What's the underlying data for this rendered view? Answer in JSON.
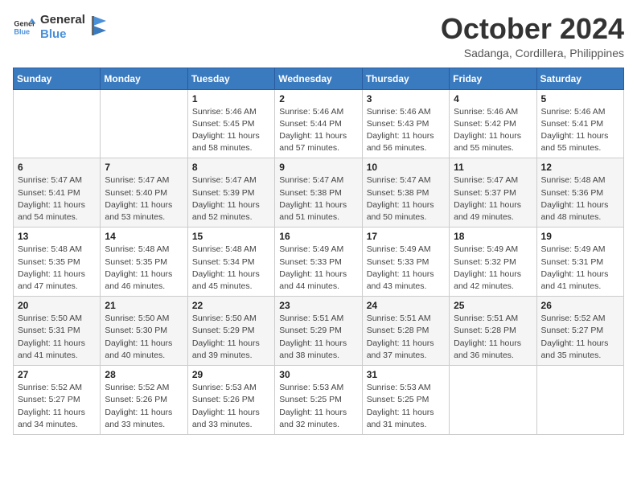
{
  "logo": {
    "text_general": "General",
    "text_blue": "Blue"
  },
  "header": {
    "title": "October 2024",
    "subtitle": "Sadanga, Cordillera, Philippines"
  },
  "days_of_week": [
    "Sunday",
    "Monday",
    "Tuesday",
    "Wednesday",
    "Thursday",
    "Friday",
    "Saturday"
  ],
  "weeks": [
    [
      {
        "day": "",
        "sunrise": "",
        "sunset": "",
        "daylight": ""
      },
      {
        "day": "",
        "sunrise": "",
        "sunset": "",
        "daylight": ""
      },
      {
        "day": "1",
        "sunrise": "Sunrise: 5:46 AM",
        "sunset": "Sunset: 5:45 PM",
        "daylight": "Daylight: 11 hours and 58 minutes."
      },
      {
        "day": "2",
        "sunrise": "Sunrise: 5:46 AM",
        "sunset": "Sunset: 5:44 PM",
        "daylight": "Daylight: 11 hours and 57 minutes."
      },
      {
        "day": "3",
        "sunrise": "Sunrise: 5:46 AM",
        "sunset": "Sunset: 5:43 PM",
        "daylight": "Daylight: 11 hours and 56 minutes."
      },
      {
        "day": "4",
        "sunrise": "Sunrise: 5:46 AM",
        "sunset": "Sunset: 5:42 PM",
        "daylight": "Daylight: 11 hours and 55 minutes."
      },
      {
        "day": "5",
        "sunrise": "Sunrise: 5:46 AM",
        "sunset": "Sunset: 5:41 PM",
        "daylight": "Daylight: 11 hours and 55 minutes."
      }
    ],
    [
      {
        "day": "6",
        "sunrise": "Sunrise: 5:47 AM",
        "sunset": "Sunset: 5:41 PM",
        "daylight": "Daylight: 11 hours and 54 minutes."
      },
      {
        "day": "7",
        "sunrise": "Sunrise: 5:47 AM",
        "sunset": "Sunset: 5:40 PM",
        "daylight": "Daylight: 11 hours and 53 minutes."
      },
      {
        "day": "8",
        "sunrise": "Sunrise: 5:47 AM",
        "sunset": "Sunset: 5:39 PM",
        "daylight": "Daylight: 11 hours and 52 minutes."
      },
      {
        "day": "9",
        "sunrise": "Sunrise: 5:47 AM",
        "sunset": "Sunset: 5:38 PM",
        "daylight": "Daylight: 11 hours and 51 minutes."
      },
      {
        "day": "10",
        "sunrise": "Sunrise: 5:47 AM",
        "sunset": "Sunset: 5:38 PM",
        "daylight": "Daylight: 11 hours and 50 minutes."
      },
      {
        "day": "11",
        "sunrise": "Sunrise: 5:47 AM",
        "sunset": "Sunset: 5:37 PM",
        "daylight": "Daylight: 11 hours and 49 minutes."
      },
      {
        "day": "12",
        "sunrise": "Sunrise: 5:48 AM",
        "sunset": "Sunset: 5:36 PM",
        "daylight": "Daylight: 11 hours and 48 minutes."
      }
    ],
    [
      {
        "day": "13",
        "sunrise": "Sunrise: 5:48 AM",
        "sunset": "Sunset: 5:35 PM",
        "daylight": "Daylight: 11 hours and 47 minutes."
      },
      {
        "day": "14",
        "sunrise": "Sunrise: 5:48 AM",
        "sunset": "Sunset: 5:35 PM",
        "daylight": "Daylight: 11 hours and 46 minutes."
      },
      {
        "day": "15",
        "sunrise": "Sunrise: 5:48 AM",
        "sunset": "Sunset: 5:34 PM",
        "daylight": "Daylight: 11 hours and 45 minutes."
      },
      {
        "day": "16",
        "sunrise": "Sunrise: 5:49 AM",
        "sunset": "Sunset: 5:33 PM",
        "daylight": "Daylight: 11 hours and 44 minutes."
      },
      {
        "day": "17",
        "sunrise": "Sunrise: 5:49 AM",
        "sunset": "Sunset: 5:33 PM",
        "daylight": "Daylight: 11 hours and 43 minutes."
      },
      {
        "day": "18",
        "sunrise": "Sunrise: 5:49 AM",
        "sunset": "Sunset: 5:32 PM",
        "daylight": "Daylight: 11 hours and 42 minutes."
      },
      {
        "day": "19",
        "sunrise": "Sunrise: 5:49 AM",
        "sunset": "Sunset: 5:31 PM",
        "daylight": "Daylight: 11 hours and 41 minutes."
      }
    ],
    [
      {
        "day": "20",
        "sunrise": "Sunrise: 5:50 AM",
        "sunset": "Sunset: 5:31 PM",
        "daylight": "Daylight: 11 hours and 41 minutes."
      },
      {
        "day": "21",
        "sunrise": "Sunrise: 5:50 AM",
        "sunset": "Sunset: 5:30 PM",
        "daylight": "Daylight: 11 hours and 40 minutes."
      },
      {
        "day": "22",
        "sunrise": "Sunrise: 5:50 AM",
        "sunset": "Sunset: 5:29 PM",
        "daylight": "Daylight: 11 hours and 39 minutes."
      },
      {
        "day": "23",
        "sunrise": "Sunrise: 5:51 AM",
        "sunset": "Sunset: 5:29 PM",
        "daylight": "Daylight: 11 hours and 38 minutes."
      },
      {
        "day": "24",
        "sunrise": "Sunrise: 5:51 AM",
        "sunset": "Sunset: 5:28 PM",
        "daylight": "Daylight: 11 hours and 37 minutes."
      },
      {
        "day": "25",
        "sunrise": "Sunrise: 5:51 AM",
        "sunset": "Sunset: 5:28 PM",
        "daylight": "Daylight: 11 hours and 36 minutes."
      },
      {
        "day": "26",
        "sunrise": "Sunrise: 5:52 AM",
        "sunset": "Sunset: 5:27 PM",
        "daylight": "Daylight: 11 hours and 35 minutes."
      }
    ],
    [
      {
        "day": "27",
        "sunrise": "Sunrise: 5:52 AM",
        "sunset": "Sunset: 5:27 PM",
        "daylight": "Daylight: 11 hours and 34 minutes."
      },
      {
        "day": "28",
        "sunrise": "Sunrise: 5:52 AM",
        "sunset": "Sunset: 5:26 PM",
        "daylight": "Daylight: 11 hours and 33 minutes."
      },
      {
        "day": "29",
        "sunrise": "Sunrise: 5:53 AM",
        "sunset": "Sunset: 5:26 PM",
        "daylight": "Daylight: 11 hours and 33 minutes."
      },
      {
        "day": "30",
        "sunrise": "Sunrise: 5:53 AM",
        "sunset": "Sunset: 5:25 PM",
        "daylight": "Daylight: 11 hours and 32 minutes."
      },
      {
        "day": "31",
        "sunrise": "Sunrise: 5:53 AM",
        "sunset": "Sunset: 5:25 PM",
        "daylight": "Daylight: 11 hours and 31 minutes."
      },
      {
        "day": "",
        "sunrise": "",
        "sunset": "",
        "daylight": ""
      },
      {
        "day": "",
        "sunrise": "",
        "sunset": "",
        "daylight": ""
      }
    ]
  ]
}
